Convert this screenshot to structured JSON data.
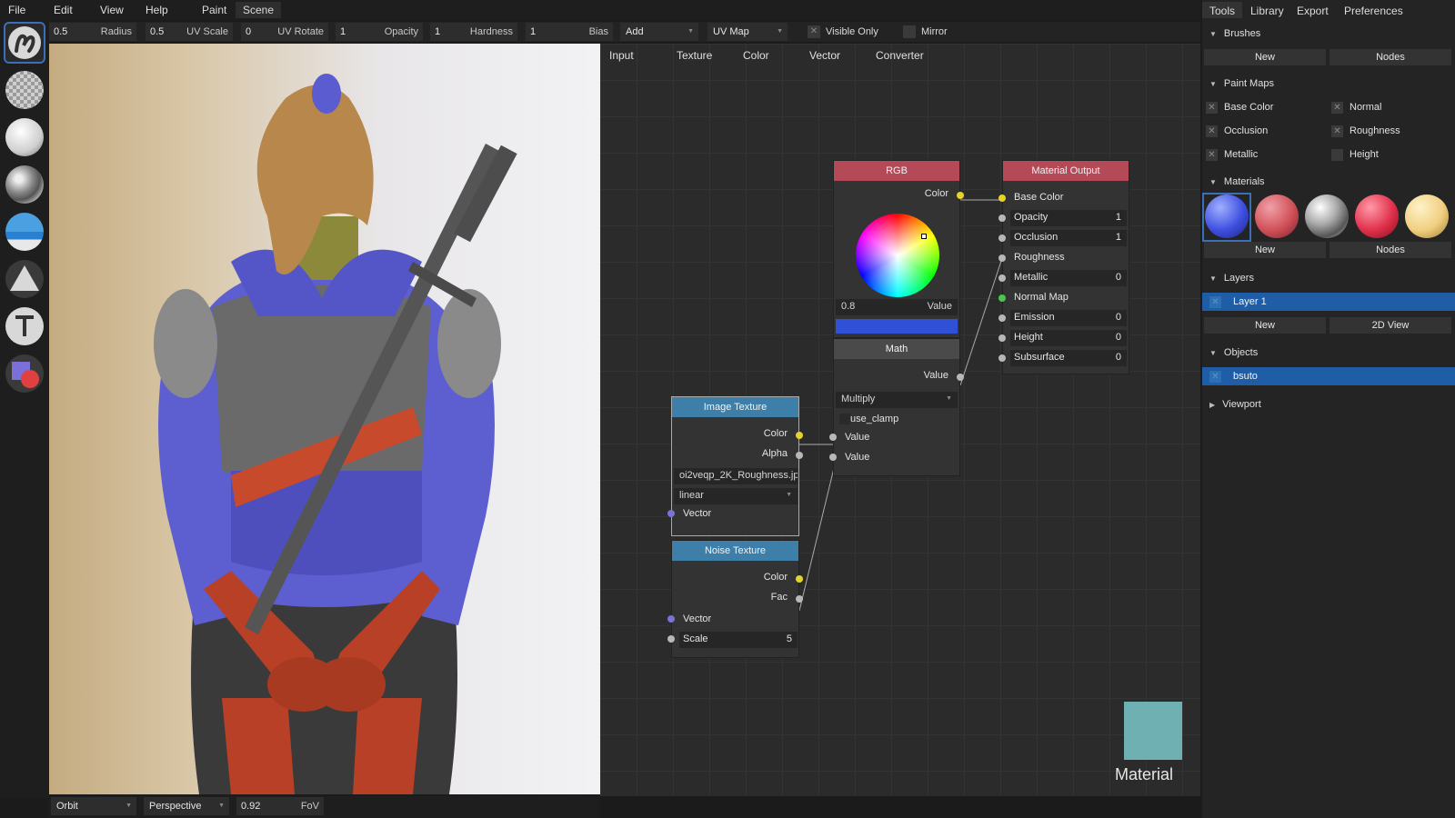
{
  "menu": {
    "items": [
      "File",
      "Edit",
      "View",
      "Help"
    ],
    "workspace_tabs": [
      "Paint",
      "Scene"
    ]
  },
  "toolbar": {
    "radius": {
      "value": "0.5",
      "label": "Radius"
    },
    "uv_scale": {
      "value": "0.5",
      "label": "UV Scale"
    },
    "uv_rotate": {
      "value": "0",
      "label": "UV Rotate"
    },
    "opacity": {
      "value": "1",
      "label": "Opacity"
    },
    "hardness": {
      "value": "1",
      "label": "Hardness"
    },
    "bias": {
      "value": "1",
      "label": "Bias"
    },
    "blend_mode": "Add",
    "projection": "UV Map",
    "visible_only": {
      "label": "Visible Only",
      "checked": true
    },
    "mirror": {
      "label": "Mirror",
      "checked": false
    }
  },
  "brushes": [
    "paint-brush-icon",
    "transparent-brush-icon",
    "clone-brush-icon",
    "noise-brush-icon",
    "fill-brush-icon",
    "triangle-shape-icon",
    "text-icon",
    "layer-decal-icon"
  ],
  "node_menu": [
    "Input",
    "Texture",
    "Color",
    "Vector",
    "Converter"
  ],
  "nodes": {
    "rgb": {
      "title": "RGB",
      "output": "Color",
      "value_num": "0.8",
      "value_label": "Value",
      "swatch_color": "#3050d8"
    },
    "material_output": {
      "title": "Material Output",
      "inputs": [
        {
          "label": "Base Color",
          "value": ""
        },
        {
          "label": "Opacity",
          "value": "1"
        },
        {
          "label": "Occlusion",
          "value": "1"
        },
        {
          "label": "Roughness",
          "value": ""
        },
        {
          "label": "Metallic",
          "value": "0"
        },
        {
          "label": "Normal Map",
          "value": ""
        },
        {
          "label": "Emission",
          "value": "0"
        },
        {
          "label": "Height",
          "value": "0"
        },
        {
          "label": "Subsurface",
          "value": "0"
        }
      ]
    },
    "math": {
      "title": "Math",
      "output": "Value",
      "operation": "Multiply",
      "clamp": "use_clamp",
      "input_a": "Value",
      "input_b": "Value"
    },
    "image_texture": {
      "title": "Image Texture",
      "out_color": "Color",
      "out_alpha": "Alpha",
      "file": "oi2veqp_2K_Roughness.jp...",
      "interp": "linear",
      "in_vector": "Vector"
    },
    "noise_texture": {
      "title": "Noise Texture",
      "out_color": "Color",
      "out_fac": "Fac",
      "in_vector": "Vector",
      "scale_label": "Scale",
      "scale_value": "5"
    }
  },
  "preview": {
    "label": "Material",
    "color": "#6fb0b2"
  },
  "viewport_bar": {
    "camera_mode": "Orbit",
    "projection": "Perspective",
    "fov_value": "0.92",
    "fov_label": "FoV"
  },
  "panel": {
    "tabs": [
      "Tools",
      "Library",
      "Export",
      "Preferences"
    ],
    "brushes": {
      "title": "Brushes",
      "new": "New",
      "nodes": "Nodes"
    },
    "paint_maps": {
      "title": "Paint Maps",
      "items": [
        "Base Color",
        "Normal",
        "Occlusion",
        "Roughness",
        "Metallic",
        "Height"
      ]
    },
    "materials": {
      "title": "Materials",
      "new": "New",
      "nodes": "Nodes"
    },
    "layers": {
      "title": "Layers",
      "items": [
        "Layer 1"
      ],
      "new": "New",
      "view2d": "2D View"
    },
    "objects": {
      "title": "Objects",
      "items": [
        "bsuto"
      ]
    },
    "viewport": {
      "title": "Viewport"
    }
  }
}
